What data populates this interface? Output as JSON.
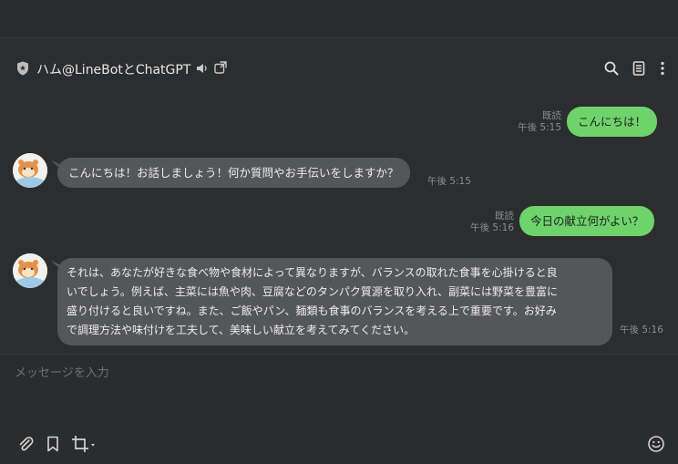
{
  "header": {
    "title": "ハム@LineBotとChatGPT"
  },
  "messages": [
    {
      "id": "m1",
      "side": "me",
      "text": "こんにちは！",
      "read": "既読",
      "time": "午後 5:15"
    },
    {
      "id": "m2",
      "side": "bot",
      "text": "こんにちは！お話しましょう！何か質問やお手伝いをしますか？",
      "time": "午後 5:15"
    },
    {
      "id": "m3",
      "side": "me",
      "text": "今日の献立何がよい？",
      "read": "既読",
      "time": "午後 5:16"
    },
    {
      "id": "m4",
      "side": "bot",
      "lines": [
        "それは、あなたが好きな食べ物や食材によって異なりますが、バランスの取れた食事を心掛けると良",
        "いでしょう。例えば、主菜には魚や肉、豆腐などのタンパク質源を取り入れ、副菜には野菜を豊富に",
        "盛り付けると良いですね。また、ご飯やパン、麺類も食事のバランスを考える上で重要です。お好み",
        "で調理方法や味付けを工夫して、美味しい献立を考えてみてください。"
      ],
      "time": "午後 5:16"
    }
  ],
  "composer": {
    "placeholder": "メッセージを入力"
  },
  "colors": {
    "background": "#2c2d2f",
    "my_bubble": "#6fd36b",
    "bot_bubble": "#555659",
    "meta_text": "#8d8e90"
  }
}
